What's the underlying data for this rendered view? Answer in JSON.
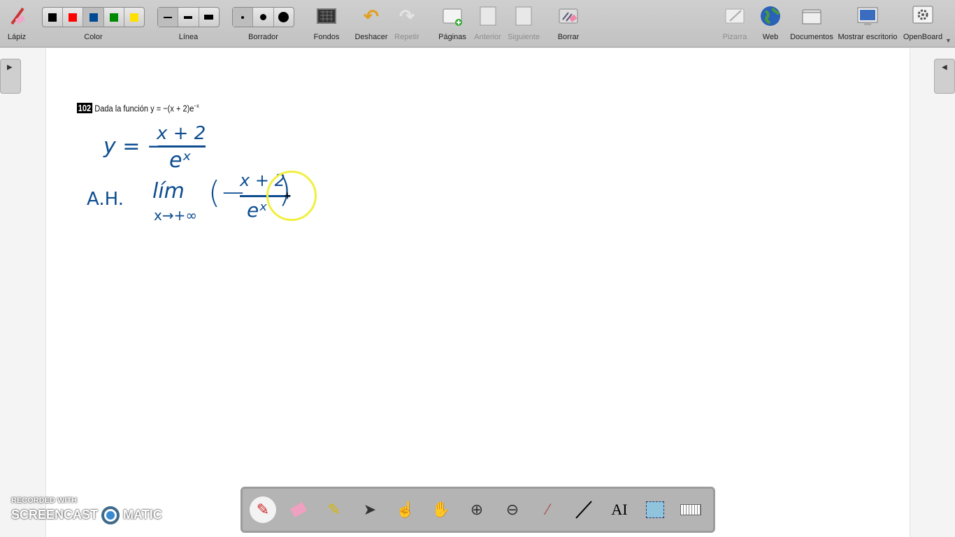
{
  "toolbar": {
    "pen": "Lápiz",
    "color": "Color",
    "colors": [
      "#000000",
      "#ff0000",
      "#004a94",
      "#008a00",
      "#ffe000"
    ],
    "selected_color": "#004a94",
    "line": "Línea",
    "eraser": "Borrador",
    "backgrounds": "Fondos",
    "undo": "Deshacer",
    "redo": "Repetir",
    "pages": "Páginas",
    "previous": "Anterior",
    "next": "Siguiente",
    "clear": "Borrar",
    "board": "Pizarra",
    "web": "Web",
    "documents": "Documentos",
    "desktop": "Mostrar escritorio",
    "openboard": "OpenBoard"
  },
  "board": {
    "problem_number": "102",
    "problem_text": "Dada la función y = −(x + 2)e",
    "problem_exp": "−x",
    "ink": {
      "line1_lhs": "y = −",
      "line1_num": "x + 2",
      "line1_den": "eˣ",
      "line2_label": "A.H.",
      "line2_lim": "lím",
      "line2_sub": "x→+∞",
      "line2_open": "(−",
      "line2_num": "x + 2",
      "line2_den": "eˣ",
      "line2_close": ")"
    }
  },
  "watermark": {
    "line1": "RECORDED WITH",
    "line2": "SCREENCAST",
    "line3": "MATIC"
  }
}
